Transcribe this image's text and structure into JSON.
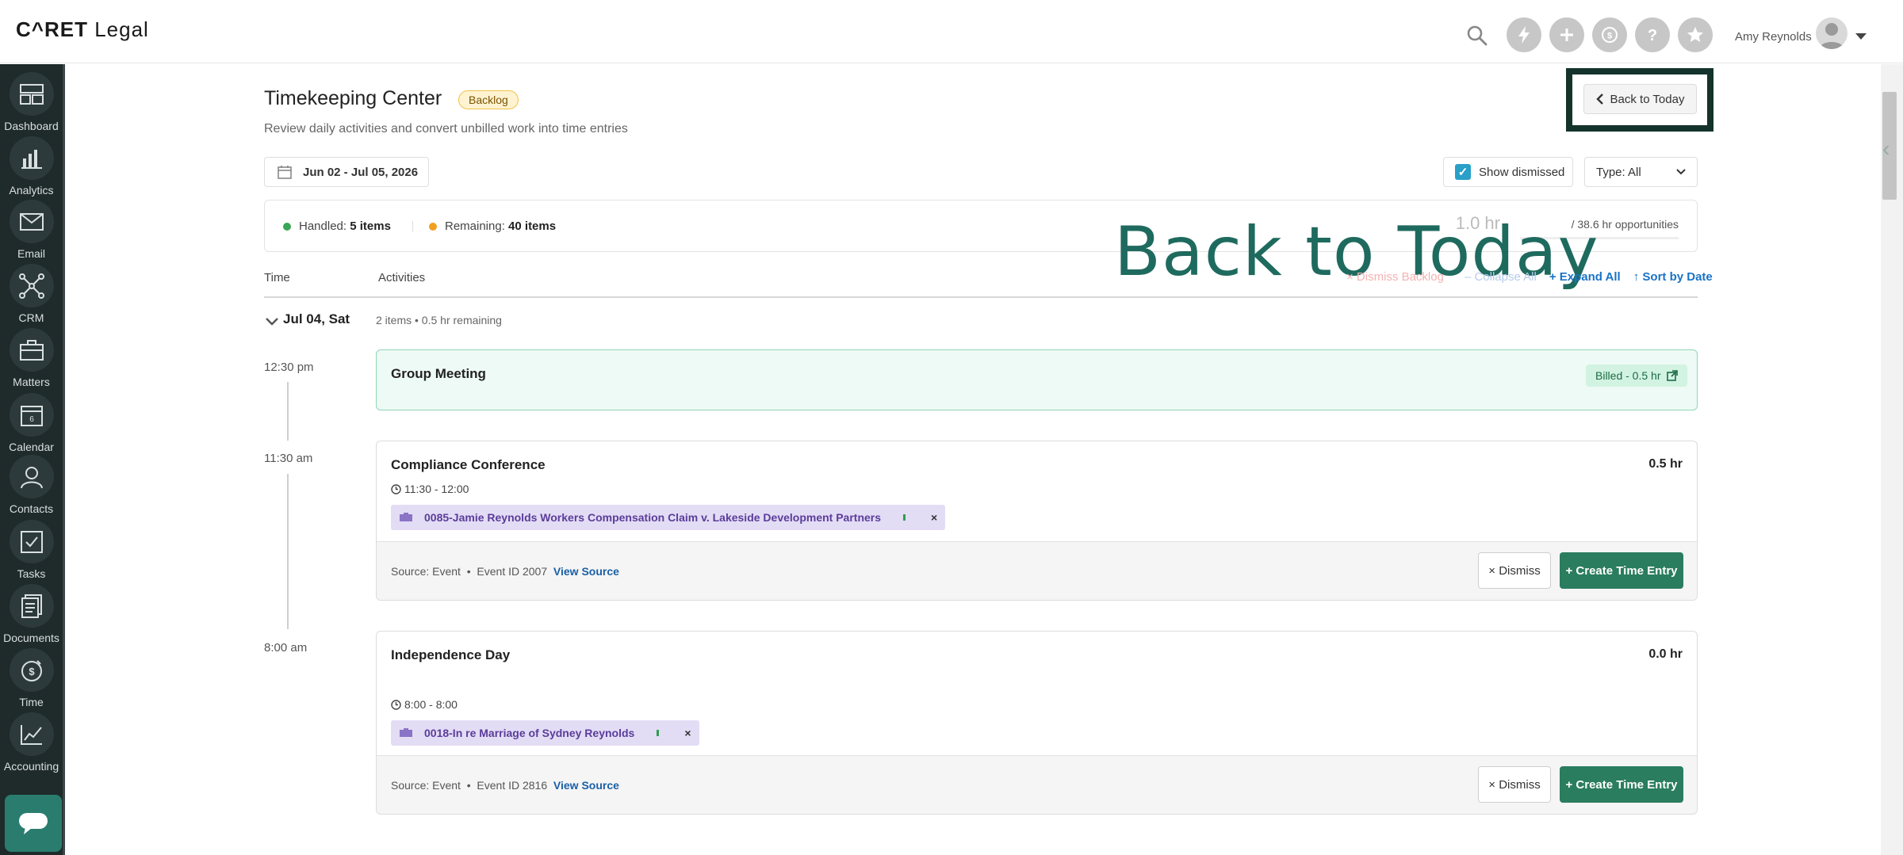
{
  "app": {
    "logo_main": "C^RET",
    "logo_sub": "Legal"
  },
  "topbar": {
    "user_name": "Amy Reynolds"
  },
  "sidebar": {
    "items": [
      {
        "label": "Dashboard",
        "icon": "dashboard-icon"
      },
      {
        "label": "Analytics",
        "icon": "analytics-icon"
      },
      {
        "label": "Email",
        "icon": "email-icon"
      },
      {
        "label": "CRM",
        "icon": "crm-icon"
      },
      {
        "label": "Matters",
        "icon": "matters-icon"
      },
      {
        "label": "Calendar",
        "icon": "calendar-icon"
      },
      {
        "label": "Contacts",
        "icon": "contacts-icon"
      },
      {
        "label": "Tasks",
        "icon": "tasks-icon"
      },
      {
        "label": "Documents",
        "icon": "documents-icon"
      },
      {
        "label": "Time",
        "icon": "time-icon"
      },
      {
        "label": "Accounting",
        "icon": "accounting-icon"
      }
    ],
    "calendar_day": "6"
  },
  "page": {
    "title": "Timekeeping Center",
    "badge": "Backlog",
    "subtitle": "Review daily activities and convert unbilled work into time entries",
    "back_button": "Back to Today",
    "overlay_text": "Back to Today"
  },
  "filters": {
    "date_range": "Jun 02 - Jul 05, 2026",
    "show_dismissed_label": "Show dismissed",
    "show_dismissed_checked": true,
    "type_select": "Type: All"
  },
  "summary": {
    "handled_label": "Handled:",
    "handled_value": "5 items",
    "remaining_label": "Remaining:",
    "remaining_value": "40 items",
    "hours": "1.0 hr",
    "opportunities": "/ 38.6 hr opportunities"
  },
  "list_header": {
    "time_col": "Time",
    "activities_col": "Activities",
    "dismiss_backlog": "× Dismiss Backlog",
    "collapse_all": "– Collapse All",
    "expand_all": "+ Expand All",
    "sort_by_date": "↑ Sort by Date"
  },
  "day": {
    "label": "Jul 04, Sat",
    "meta": "2 items • 0.5 hr remaining"
  },
  "entries": [
    {
      "time": "12:30 pm",
      "title": "Group Meeting",
      "billed": "Billed - 0.5 hr"
    },
    {
      "time": "11:30 am",
      "title": "Compliance Conference",
      "hours": "0.5 hr",
      "range": "11:30 - 12:00",
      "matter": "0085-Jamie Reynolds Workers Compensation Claim v. Lakeside Development Partners",
      "source": "Source: Event",
      "event_id": "Event ID 2007",
      "view_source": "View Source",
      "dismiss": "× Dismiss",
      "create": "+ Create Time Entry"
    },
    {
      "time": "8:00 am",
      "title": "Independence Day",
      "hours": "0.0 hr",
      "range": "8:00 - 8:00",
      "matter": "0018-In re Marriage of Sydney Reynolds",
      "source": "Source: Event",
      "event_id": "Event ID 2816",
      "view_source": "View Source",
      "dismiss": "× Dismiss",
      "create": "+ Create Time Entry"
    }
  ]
}
